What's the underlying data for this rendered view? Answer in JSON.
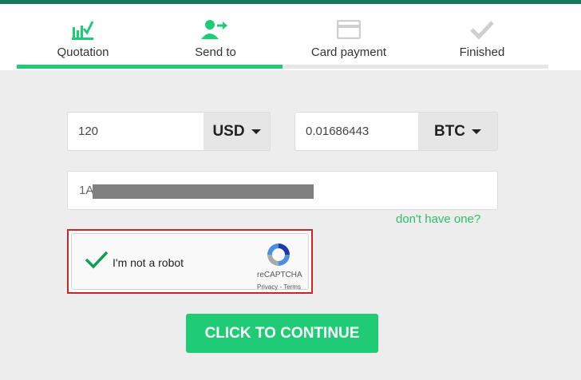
{
  "steps": [
    {
      "label": "Quotation",
      "icon": "chart-check-icon",
      "state": "active"
    },
    {
      "label": "Send to",
      "icon": "user-send-icon",
      "state": "done"
    },
    {
      "label": "Card payment",
      "icon": "card-icon",
      "state": "pending"
    },
    {
      "label": "Finished",
      "icon": "check-icon",
      "state": "pending"
    }
  ],
  "colors": {
    "accent": "#1fcb74",
    "topbar": "#147a5c",
    "link": "#2ebd6b",
    "captcha_border": "#c62828"
  },
  "form": {
    "amount": "120",
    "from_currency": "USD",
    "converted": "0.01686443",
    "to_currency": "BTC",
    "address_visible": "1A",
    "missing_wallet_link": "don't have one?"
  },
  "captcha": {
    "label": "I'm not a robot",
    "brand": "reCAPTCHA",
    "links": "Privacy - Terms"
  },
  "cta_label": "CLICK TO CONTINUE"
}
